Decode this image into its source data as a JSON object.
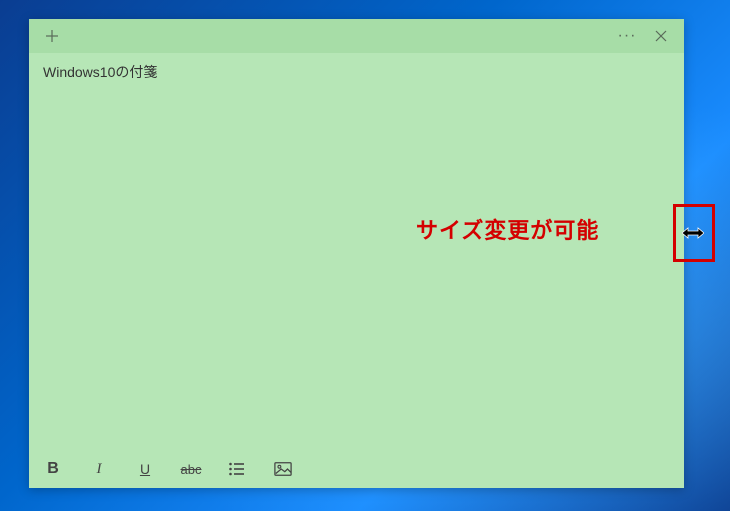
{
  "note": {
    "content": "Windows10の付箋"
  },
  "toolbar": {
    "bold_label": "B",
    "italic_label": "I",
    "underline_label": "U",
    "strike_label": "abc"
  },
  "annotation": {
    "text": "サイズ変更が可能"
  }
}
